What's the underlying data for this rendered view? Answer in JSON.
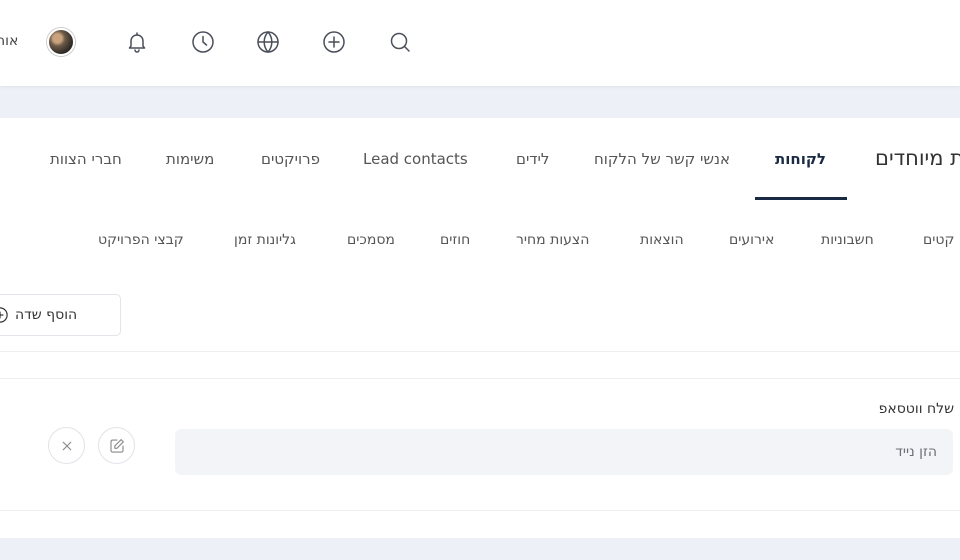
{
  "header": {
    "user_name": "אוה",
    "icons": [
      "avatar",
      "bell-icon",
      "clock-icon",
      "globe-icon",
      "plus-circle-icon",
      "search-icon"
    ]
  },
  "main_tabs": {
    "section_title": "ת מיוחדים",
    "items": [
      {
        "label": "לקוחות",
        "active": true
      },
      {
        "label": "אנשי קשר של הלקוח"
      },
      {
        "label": "לידים"
      },
      {
        "label": "Lead contacts"
      },
      {
        "label": "פרויקטים"
      },
      {
        "label": "משימות"
      },
      {
        "label": "חברי הצוות"
      }
    ]
  },
  "sub_tabs": {
    "items": [
      {
        "label": "קטים"
      },
      {
        "label": "חשבוניות"
      },
      {
        "label": "אירועים"
      },
      {
        "label": "הוצאות"
      },
      {
        "label": "הצעות מחיר"
      },
      {
        "label": "חוזים"
      },
      {
        "label": "מסמכים"
      },
      {
        "label": "גליונות זמן"
      },
      {
        "label": "קבצי הפרויקט"
      }
    ]
  },
  "actions": {
    "add_field_label": "הוסף שדה"
  },
  "field": {
    "label": "שלח ווטסאפ",
    "placeholder": "הזן נייד"
  }
}
